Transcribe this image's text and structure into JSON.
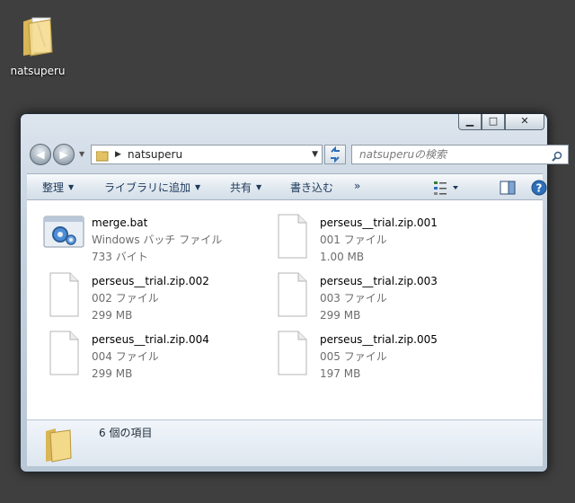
{
  "desktop": {
    "icon_label": "natsuperu",
    "icon": "folder-icon"
  },
  "window": {
    "buttons": {
      "minimize": "minimize-icon",
      "maximize": "maximize-icon",
      "close": "close-icon"
    },
    "address": {
      "path": "natsuperu",
      "icons": [
        "back-arrow-icon",
        "forward-arrow-icon",
        "folder-icon",
        "refresh-icon"
      ]
    },
    "search": {
      "placeholder": "natsuperuの検索",
      "icon": "search-icon"
    },
    "toolbar": {
      "organize": "整理",
      "add_to_library": "ライブラリに追加",
      "share": "共有",
      "burn": "書き込む",
      "more": "»",
      "icons": [
        "view-options-icon",
        "preview-pane-icon",
        "help-icon"
      ]
    },
    "files": [
      {
        "name": "merge.bat",
        "type": "Windows バッチ ファイル",
        "size": "733 バイト",
        "icon": "batch-file-icon"
      },
      {
        "name": "perseus__trial.zip.001",
        "type": "001 ファイル",
        "size": "1.00 MB",
        "icon": "blank-file-icon"
      },
      {
        "name": "perseus__trial.zip.002",
        "type": "002 ファイル",
        "size": "299 MB",
        "icon": "blank-file-icon"
      },
      {
        "name": "perseus__trial.zip.003",
        "type": "003 ファイル",
        "size": "299 MB",
        "icon": "blank-file-icon"
      },
      {
        "name": "perseus__trial.zip.004",
        "type": "004 ファイル",
        "size": "299 MB",
        "icon": "blank-file-icon"
      },
      {
        "name": "perseus__trial.zip.005",
        "type": "005 ファイル",
        "size": "197 MB",
        "icon": "blank-file-icon"
      }
    ],
    "status": {
      "item_count": "6 個の項目",
      "icon": "folder-icon"
    }
  }
}
